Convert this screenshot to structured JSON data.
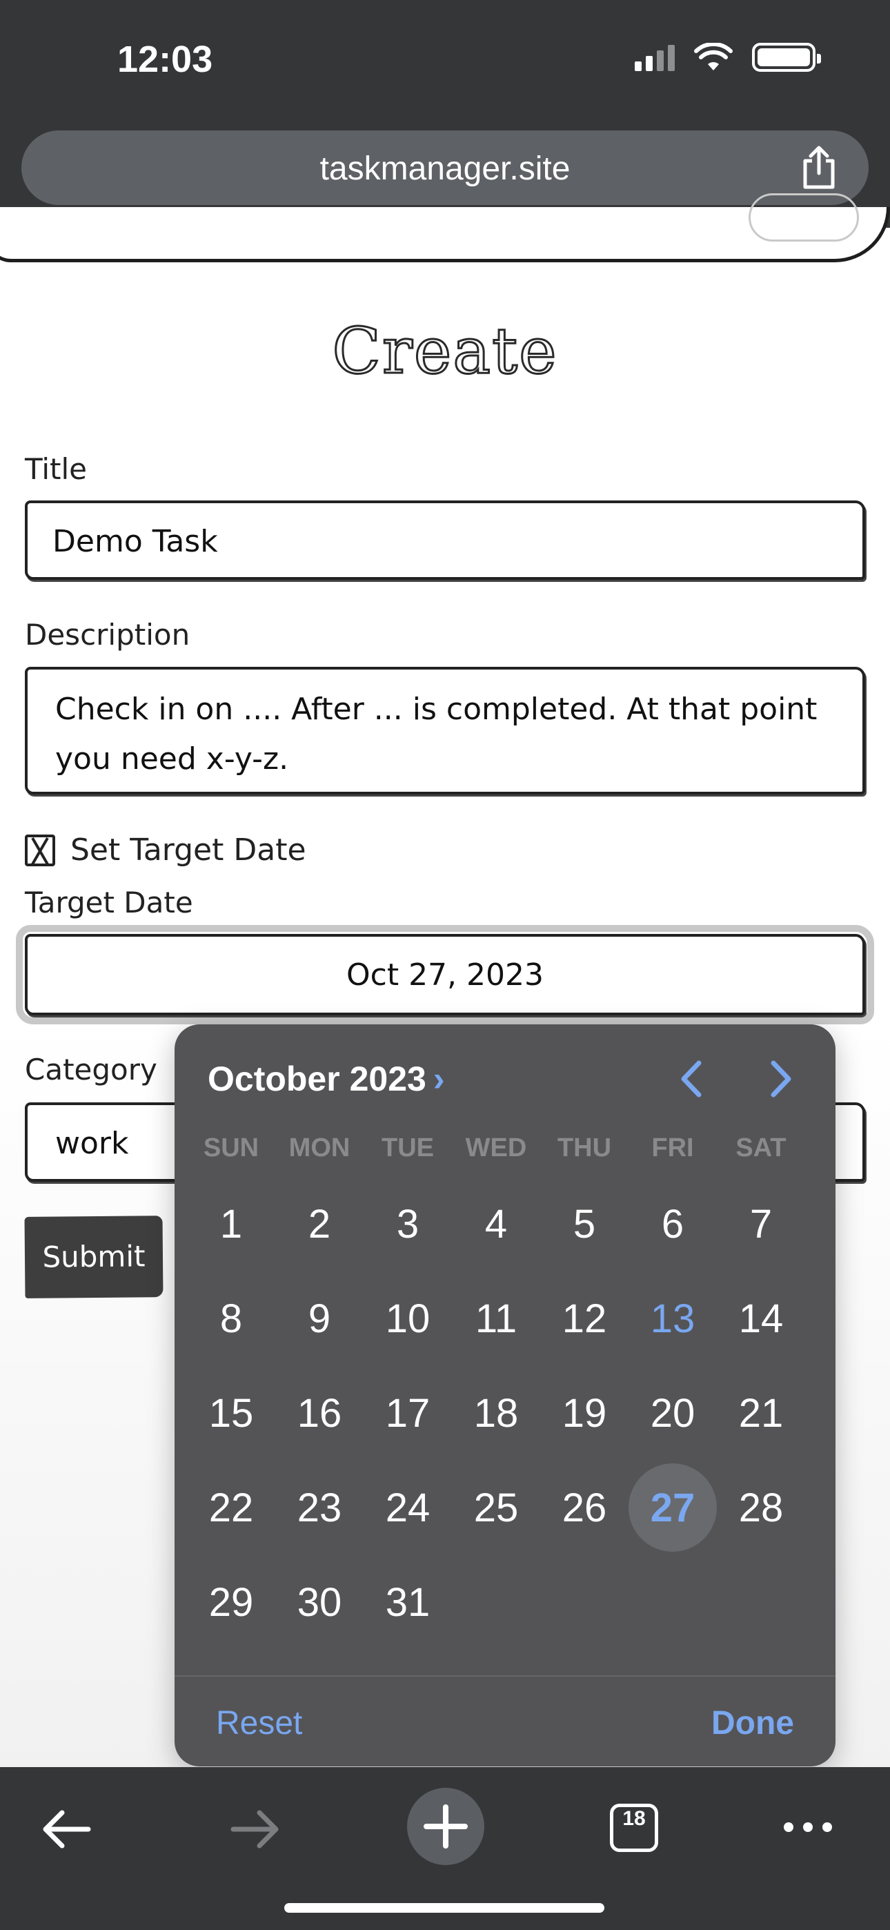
{
  "status_bar": {
    "time": "12:03"
  },
  "browser": {
    "url": "taskmanager.site",
    "open_tab_count": "18"
  },
  "form": {
    "heading": "Create",
    "title_label": "Title",
    "title_value": "Demo Task",
    "description_label": "Description",
    "description_value": "Check in on .... After ... is completed.  At that point you need x-y-z.",
    "set_target_date_label": "Set Target Date",
    "set_target_date_checked": true,
    "target_date_label": "Target Date",
    "target_date_value": "Oct 27, 2023",
    "category_label": "Category",
    "category_value": "work",
    "submit_label": "Submit"
  },
  "date_picker": {
    "month_label": "October 2023",
    "weekdays": [
      "SUN",
      "MON",
      "TUE",
      "WED",
      "THU",
      "FRI",
      "SAT"
    ],
    "first_weekday_index": 0,
    "days_in_month": 31,
    "today": 13,
    "selected": 27,
    "reset_label": "Reset",
    "done_label": "Done"
  },
  "colors": {
    "accent": "#7aa7f0",
    "picker_bg": "#545457",
    "chrome_bg": "#343638"
  }
}
